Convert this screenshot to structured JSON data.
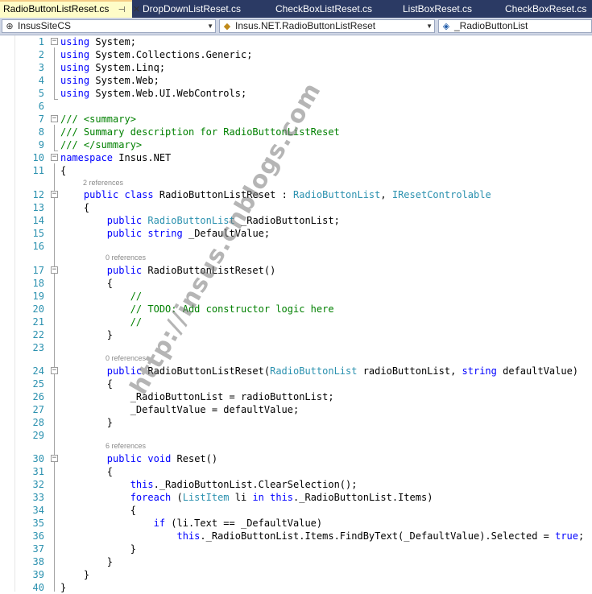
{
  "tabs": [
    {
      "label": "RadioButtonListReset.cs",
      "active": true
    },
    {
      "label": "DropDownListReset.cs",
      "active": false
    },
    {
      "label": "CheckBoxListReset.cs",
      "active": false
    },
    {
      "label": "ListBoxReset.cs",
      "active": false
    },
    {
      "label": "CheckBoxReset.cs",
      "active": false
    }
  ],
  "nav": {
    "project": "InsusSiteCS",
    "type": "Insus.NET.RadioButtonListReset",
    "member": "_RadioButtonList"
  },
  "code_lines": [
    {
      "num": "1",
      "text": "using System;"
    },
    {
      "num": "2",
      "text": "using System.Collections.Generic;"
    },
    {
      "num": "3",
      "text": "using System.Linq;"
    },
    {
      "num": "4",
      "text": "using System.Web;"
    },
    {
      "num": "5",
      "text": "using System.Web.UI.WebControls;"
    },
    {
      "num": "6",
      "text": ""
    },
    {
      "num": "7",
      "text": "/// <summary>"
    },
    {
      "num": "8",
      "text": "/// Summary description for RadioButtonListReset"
    },
    {
      "num": "9",
      "text": "/// </summary>"
    },
    {
      "num": "10",
      "text": "namespace Insus.NET"
    },
    {
      "num": "11",
      "text": "{"
    },
    {
      "num": "12",
      "text": "    public class RadioButtonListReset : RadioButtonList, IResetControlable"
    },
    {
      "num": "13",
      "text": "    {"
    },
    {
      "num": "14",
      "text": "        public RadioButtonList _RadioButtonList;"
    },
    {
      "num": "15",
      "text": "        public string _DefaultValue;"
    },
    {
      "num": "16",
      "text": ""
    },
    {
      "num": "17",
      "text": "        public RadioButtonListReset()"
    },
    {
      "num": "18",
      "text": "        {"
    },
    {
      "num": "19",
      "text": "            //"
    },
    {
      "num": "20",
      "text": "            // TODO: Add constructor logic here"
    },
    {
      "num": "21",
      "text": "            //"
    },
    {
      "num": "22",
      "text": "        }"
    },
    {
      "num": "23",
      "text": ""
    },
    {
      "num": "24",
      "text": "        public RadioButtonListReset(RadioButtonList radioButtonList, string defaultValue)"
    },
    {
      "num": "25",
      "text": "        {"
    },
    {
      "num": "26",
      "text": "            _RadioButtonList = radioButtonList;"
    },
    {
      "num": "27",
      "text": "            _DefaultValue = defaultValue;"
    },
    {
      "num": "28",
      "text": "        }"
    },
    {
      "num": "29",
      "text": ""
    },
    {
      "num": "30",
      "text": "        public void Reset()"
    },
    {
      "num": "31",
      "text": "        {"
    },
    {
      "num": "32",
      "text": "            this._RadioButtonList.ClearSelection();"
    },
    {
      "num": "33",
      "text": "            foreach (ListItem li in this._RadioButtonList.Items)"
    },
    {
      "num": "34",
      "text": "            {"
    },
    {
      "num": "35",
      "text": "                if (li.Text == _DefaultValue)"
    },
    {
      "num": "36",
      "text": "                    this._RadioButtonList.Items.FindByText(_DefaultValue).Selected = true;"
    },
    {
      "num": "37",
      "text": "            }"
    },
    {
      "num": "38",
      "text": "        }"
    },
    {
      "num": "39",
      "text": "    }"
    },
    {
      "num": "40",
      "text": "}"
    }
  ],
  "codelens": {
    "class_refs": "2 references",
    "ctor_refs": "0 references",
    "ctor2_refs": "0 references",
    "reset_refs": "6 references"
  },
  "watermark": "http://insus.cnblogs.com",
  "colors": {
    "keyword": "#0000ff",
    "type": "#2b91af",
    "comment": "#008000",
    "line_number": "#2b91af",
    "tab_bar": "#2b3a64",
    "active_tab": "#fefcc8"
  }
}
